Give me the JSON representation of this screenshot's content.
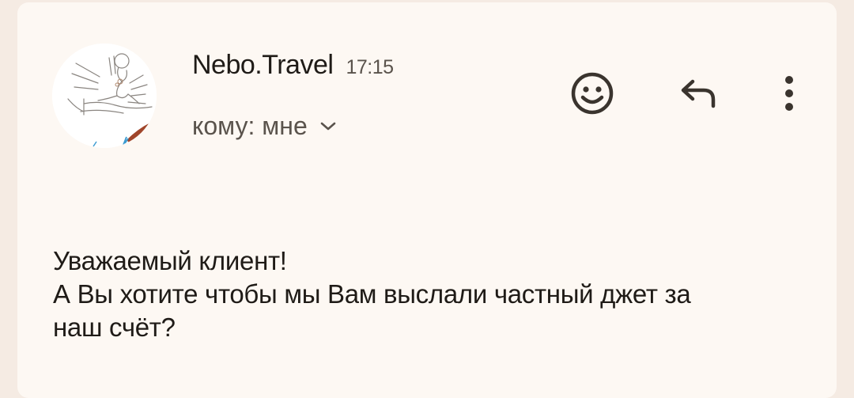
{
  "colors": {
    "page_background": "#f5ebe3",
    "card_background": "#fdf8f3",
    "text_primary": "#1f1b17",
    "text_secondary": "#5a534c",
    "icon_color": "#3a342e"
  },
  "email": {
    "sender": "Nebo.Travel",
    "time": "17:15",
    "recipient": "кому: мне",
    "avatar_icon": "sender-avatar-illustration",
    "actions": {
      "emoji_icon": "smiley-icon",
      "reply_icon": "reply-icon",
      "more_icon": "more-vert-icon",
      "expand_icon": "chevron-down-icon"
    },
    "body_lines": [
      "Уважаемый клиент!",
      "А Вы хотите чтобы мы Вам выслали частный джет за",
      "наш счёт?"
    ]
  }
}
